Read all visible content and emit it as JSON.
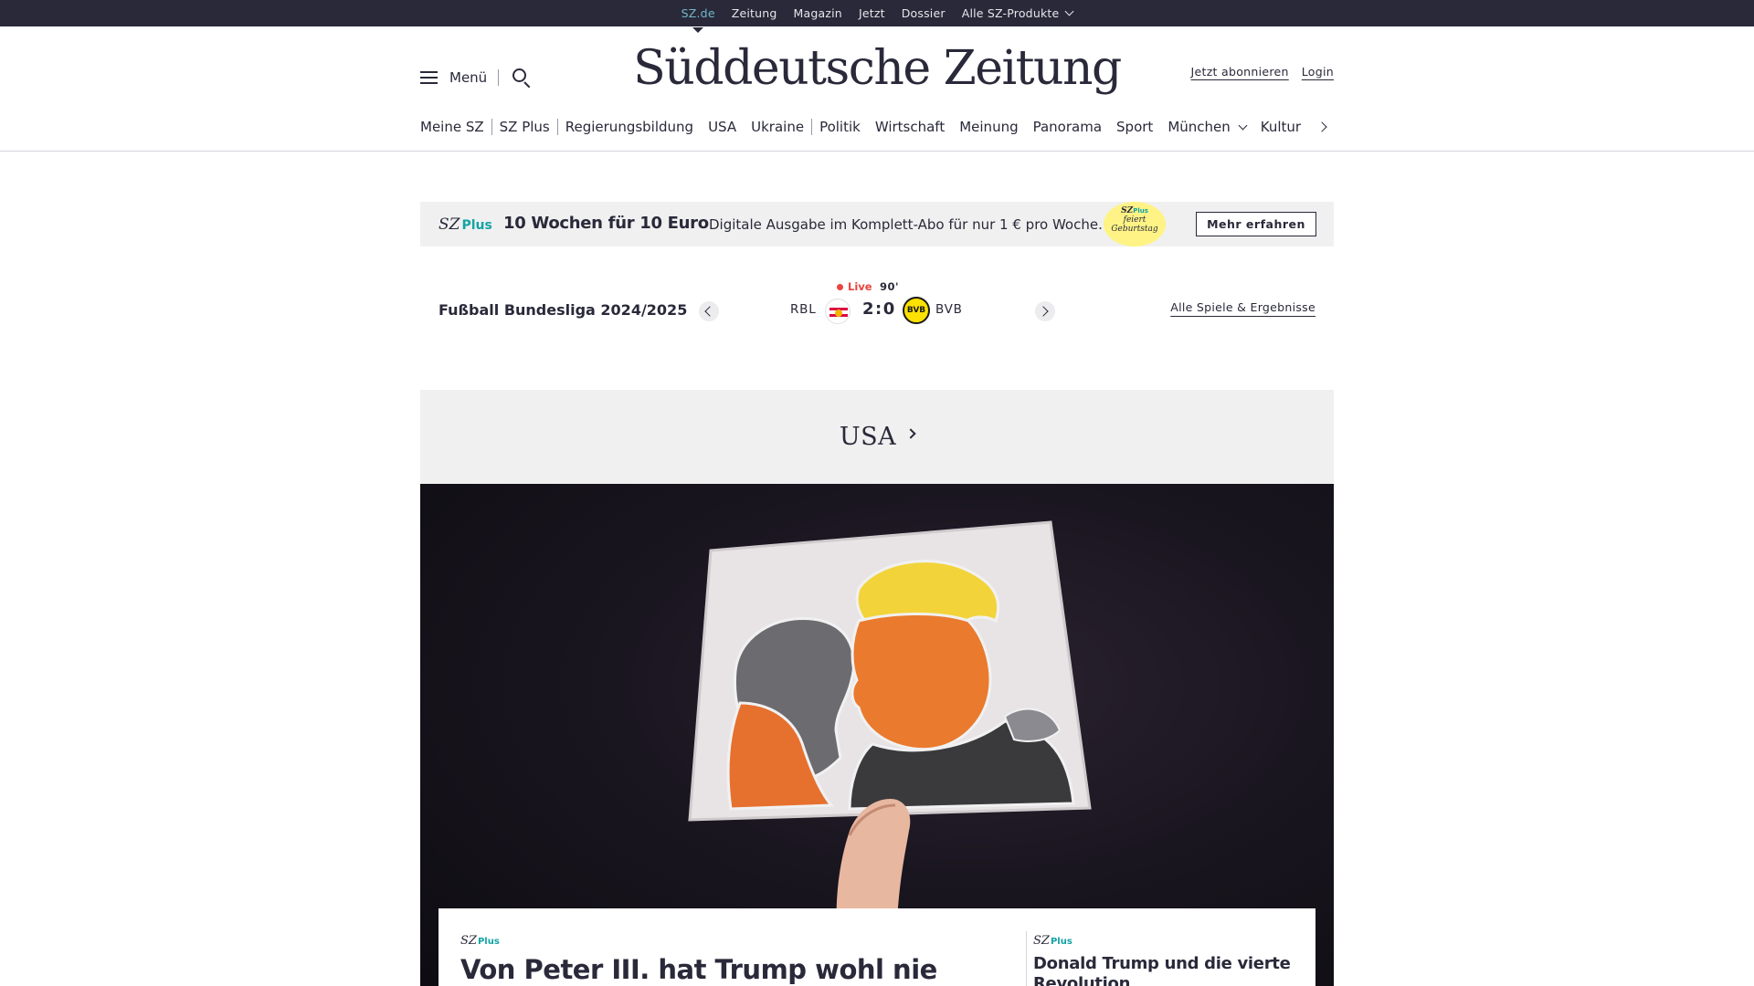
{
  "topbar": {
    "links": [
      {
        "label": "SZ.de"
      },
      {
        "label": "Zeitung"
      },
      {
        "label": "Magazin"
      },
      {
        "label": "Jetzt"
      },
      {
        "label": "Dossier"
      },
      {
        "label": "Alle SZ-Produkte"
      }
    ]
  },
  "header": {
    "menu_label": "Menü",
    "logo": "Süddeutsche Zeitung",
    "subscribe_label": "Jetzt abonnieren",
    "login_label": "Login",
    "ressorts": [
      {
        "label": "Meine SZ"
      },
      {
        "label": "SZ Plus"
      },
      {
        "label": "Regierungsbildung"
      },
      {
        "label": "USA"
      },
      {
        "label": "Ukraine"
      },
      {
        "label": "Politik"
      },
      {
        "label": "Wirtschaft"
      },
      {
        "label": "Meinung"
      },
      {
        "label": "Panorama"
      },
      {
        "label": "Sport"
      },
      {
        "label": "München"
      },
      {
        "label": "Kultur"
      }
    ]
  },
  "promo": {
    "logo_sz": "SZ",
    "logo_plus": "Plus",
    "headline": "10 Wochen für 10 Euro",
    "text": "Digitale Ausgabe im Komplett-Abo für nur 1 € pro Woche.",
    "badge_sz": "SZ",
    "badge_plus": "Plus",
    "badge_line1": "feiert",
    "badge_line2": "Geburtstag",
    "button_label": "Mehr erfahren"
  },
  "scoreboard": {
    "league": "Fußball Bundesliga 2024/2025",
    "live_label": "Live",
    "minute": "90'",
    "home_team": "RBL",
    "away_team": "BVB",
    "score": "2:0",
    "bvb_crest_text": "BVB",
    "all_games_label": "Alle Spiele & Ergebnisse"
  },
  "section": {
    "title": "USA"
  },
  "teaser": {
    "main": {
      "kicker_sz": "SZ",
      "kicker_plus": "Plus",
      "headline": "Von Peter III. hat Trump wohl nie"
    },
    "side": {
      "kicker_sz": "SZ",
      "kicker_plus": "Plus",
      "headline": "Donald Trump und die vierte Revolution"
    }
  },
  "colors": {
    "topbar_bg": "#29293a",
    "active_link": "#71b9c8",
    "sz_plus_accent": "#14a3a3",
    "live_red": "#e9453d",
    "badge_yellow": "#fff385"
  }
}
